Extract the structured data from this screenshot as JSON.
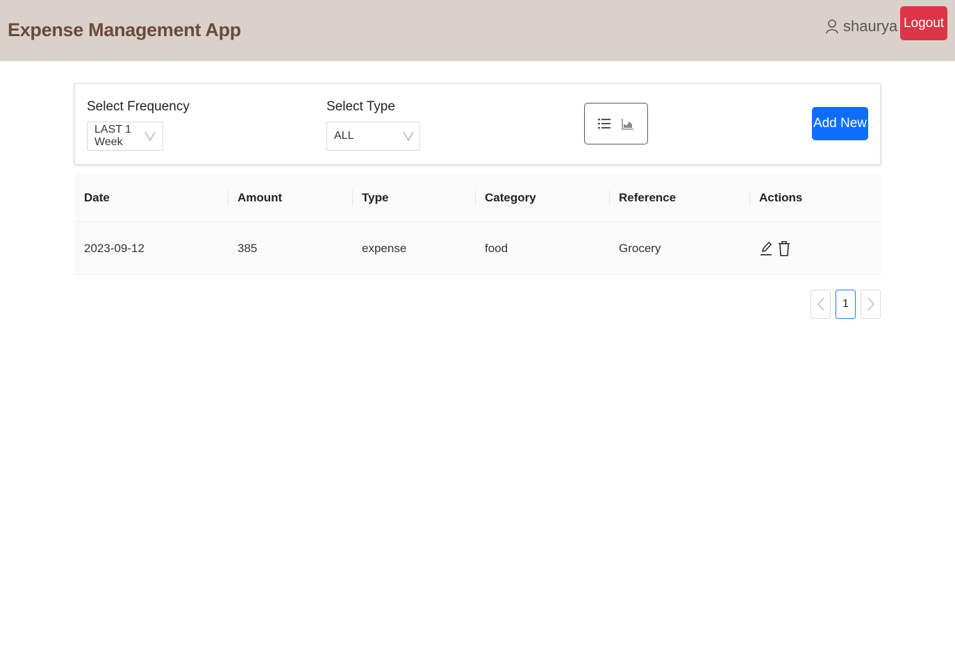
{
  "header": {
    "title": "Expense Management App",
    "username": "shaurya",
    "user_icon": "user-icon",
    "logout_label": "Logout"
  },
  "filters": {
    "frequency_label": "Select Frequency",
    "frequency_value": "LAST 1 Week",
    "type_label": "Select Type",
    "type_value": "ALL",
    "view_toggle_icons": [
      "list-icon",
      "area-chart-icon"
    ],
    "add_new_label": "Add New"
  },
  "table": {
    "columns": [
      "Date",
      "Amount",
      "Type",
      "Category",
      "Reference",
      "Actions"
    ],
    "rows": [
      {
        "date": "2023-09-12",
        "amount": "385",
        "type": "expense",
        "category": "food",
        "reference": "Grocery",
        "action_icons": [
          "edit-icon",
          "delete-icon"
        ]
      }
    ]
  },
  "pagination": {
    "current_page": "1"
  },
  "colors": {
    "header_bg": "#dbd1cb",
    "brand_text": "#6b4a39",
    "logout_bg": "#dc3545",
    "primary": "#0d6efd",
    "active_page_border": "#1677ff"
  }
}
